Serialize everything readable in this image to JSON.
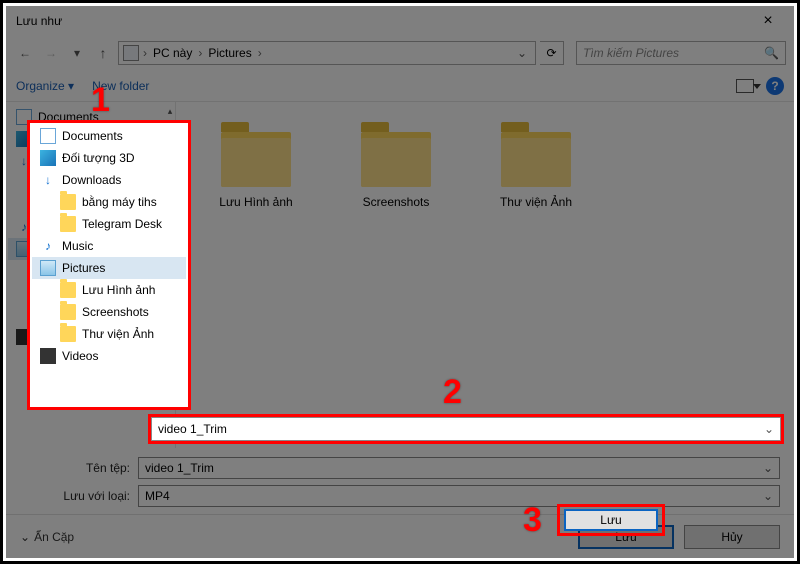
{
  "window": {
    "title": "Lưu như"
  },
  "nav": {
    "crumb1": "PC này",
    "crumb2": "Pictures",
    "search_placeholder": "Tìm kiếm Pictures"
  },
  "toolbar": {
    "organize": "Organize",
    "new_folder": "New folder",
    "help": "?"
  },
  "tree": {
    "items": [
      {
        "label": "Documents",
        "icon": "doc",
        "indent": false
      },
      {
        "label": "Đối tượng 3D",
        "icon": "cube",
        "indent": false
      },
      {
        "label": "Downloads",
        "icon": "dl",
        "indent": false
      },
      {
        "label": "bằng máy tihs",
        "icon": "folder",
        "indent": true
      },
      {
        "label": "Telegram Desk",
        "icon": "folder",
        "indent": true
      },
      {
        "label": "Music",
        "icon": "music",
        "indent": false
      },
      {
        "label": "Pictures",
        "icon": "pic",
        "indent": false,
        "selected": true
      },
      {
        "label": "Lưu Hình ảnh",
        "icon": "folder",
        "indent": true
      },
      {
        "label": "Screenshots",
        "icon": "folder",
        "indent": true
      },
      {
        "label": "Thư viện Ảnh",
        "icon": "folder",
        "indent": true
      },
      {
        "label": "Videos",
        "icon": "vid",
        "indent": false
      }
    ]
  },
  "content": {
    "folders": [
      {
        "label": "Lưu Hình ảnh"
      },
      {
        "label": "Screenshots"
      },
      {
        "label": "Thư viện Ảnh"
      }
    ]
  },
  "form": {
    "filename_label": "Tên tệp:",
    "filename_value": "video 1_Trim",
    "filetype_label": "Lưu với loại:",
    "filetype_value": "MP4"
  },
  "footer": {
    "hide_folders": "Ẩn Cặp",
    "save": "Lưu",
    "cancel": "Hủy"
  },
  "annotations": {
    "n1": "1",
    "n2": "2",
    "n3": "3"
  }
}
